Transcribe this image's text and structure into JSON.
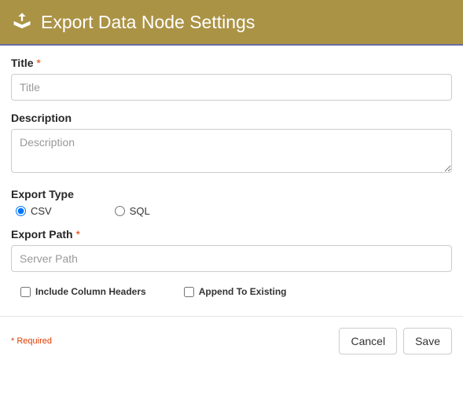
{
  "header": {
    "title": "Export Data Node Settings"
  },
  "fields": {
    "title": {
      "label": "Title",
      "required_star": "*",
      "placeholder": "Title",
      "value": ""
    },
    "description": {
      "label": "Description",
      "placeholder": "Description",
      "value": ""
    },
    "export_type": {
      "label": "Export Type",
      "options": {
        "csv": "CSV",
        "sql": "SQL"
      },
      "selected": "csv"
    },
    "export_path": {
      "label": "Export Path",
      "required_star": "*",
      "placeholder": "Server Path",
      "value": ""
    },
    "checkboxes": {
      "include_headers": {
        "label": "Include Column Headers",
        "checked": false
      },
      "append_existing": {
        "label": "Append To Existing",
        "checked": false
      }
    }
  },
  "footer": {
    "required_note": "* Required",
    "cancel_label": "Cancel",
    "save_label": "Save"
  }
}
